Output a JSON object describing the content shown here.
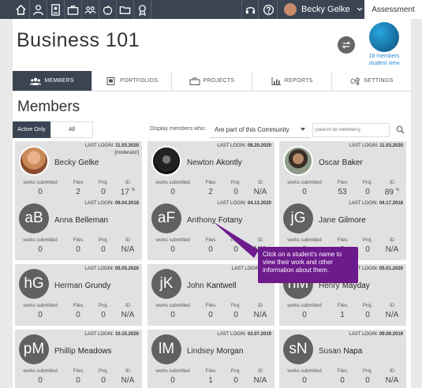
{
  "nav": {
    "icons": [
      "home-icon",
      "person-icon",
      "id-card-icon",
      "briefcase-icon",
      "group-icon",
      "apple-icon",
      "folder-icon",
      "badge-icon"
    ],
    "right_icons": [
      "headset-icon",
      "help-icon"
    ],
    "user_name": "Becky Gelke",
    "assessment_tab": "Assessment"
  },
  "header": {
    "title": "Business 101",
    "members_link": "18 members student view"
  },
  "tabs": [
    {
      "label": "MEMBERS",
      "icon": "members-icon",
      "active": true
    },
    {
      "label": "PORTFOLIOS",
      "icon": "portfolios-icon",
      "active": false
    },
    {
      "label": "PROJECTS",
      "icon": "projects-icon",
      "active": false
    },
    {
      "label": "REPORTS",
      "icon": "reports-icon",
      "active": false
    },
    {
      "label": "SETTINGS",
      "icon": "settings-icon",
      "active": false
    }
  ],
  "members": {
    "title": "Members",
    "filter_active": "Active Only",
    "filter_all": "All",
    "display_label": "Display members who:",
    "display_value": "Are part of this Community",
    "search_placeholder": "[search for members]"
  },
  "stat_labels": {
    "works": "works submitted",
    "files": "Files",
    "proj": "Proj.",
    "id": "ID"
  },
  "last_login_label": "LAST LOGIN:",
  "cards": [
    {
      "first": "Becky",
      "last": "Gelke",
      "initials": "",
      "photo": "woman",
      "login": "11.03.2020",
      "moderator": "[moderator]",
      "works": "0",
      "files": "2",
      "proj": "0",
      "id": "17",
      "id_pct": "%"
    },
    {
      "first": "Newton",
      "last": "Akontly",
      "initials": "",
      "photo": "dark",
      "login": "08.20.2020",
      "works": "0",
      "files": "2",
      "proj": "0",
      "id": "N/A"
    },
    {
      "first": "Oscar",
      "last": "Baker",
      "initials": "",
      "photo": "man",
      "login": "11.03.2020",
      "works": "0",
      "files": "53",
      "proj": "0",
      "id": "89",
      "id_pct": "%"
    },
    {
      "first": "Anna",
      "last": "Belleman",
      "initials": "aB",
      "login": "09.04.2018",
      "works": "0",
      "files": "0",
      "proj": "0",
      "id": "N/A"
    },
    {
      "first": "Anthony",
      "last": "Fotany",
      "initials": "aF",
      "login": "04.13.2020",
      "works": "0",
      "files": "0",
      "proj": "0",
      "id": "N/A"
    },
    {
      "first": "Jane",
      "last": "Gilmore",
      "initials": "jG",
      "login": "04.17.2018",
      "works": "0",
      "files": "0",
      "proj": "0",
      "id": "N/A"
    },
    {
      "first": "Herman",
      "last": "Grundy",
      "initials": "hG",
      "login": "05.05.2020",
      "works": "0",
      "files": "0",
      "proj": "0",
      "id": "N/A"
    },
    {
      "first": "John",
      "last": "Kantwell",
      "initials": "jK",
      "login": "05.2",
      "works": "0",
      "files": "0",
      "proj": "0",
      "id": "N/A"
    },
    {
      "first": "Henry",
      "last": "Mayday",
      "initials": "hM",
      "login": "05.01.2020",
      "works": "0",
      "files": "1",
      "proj": "0",
      "id": "N/A"
    },
    {
      "first": "Phillip",
      "last": "Meadows",
      "initials": "pM",
      "login": "10.15.2020",
      "works": "0",
      "files": "0",
      "proj": "0",
      "id": "N/A"
    },
    {
      "first": "Lindsey",
      "last": "Morgan",
      "initials": "lM",
      "login": "03.07.2019",
      "works": "0",
      "files": "1",
      "proj": "0",
      "id": "N/A"
    },
    {
      "first": "Susan",
      "last": "Napa",
      "initials": "sN",
      "login": "09.09.2019",
      "works": "0",
      "files": "0",
      "proj": "0",
      "id": "N/A"
    }
  ],
  "tooltip": "Click on a student's name to view their work and other information about them."
}
